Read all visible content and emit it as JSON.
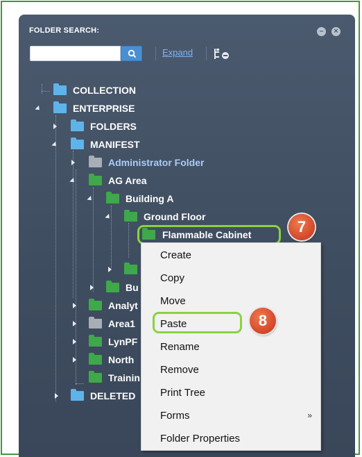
{
  "panel": {
    "title": "FOLDER SEARCH:",
    "minimize_icon": "minus-circle-icon",
    "close_icon": "close-circle-icon",
    "search": {
      "value": "",
      "placeholder": "",
      "button_icon": "search-icon"
    },
    "expand_label": "Expand",
    "tree_options_icon": "tree-options-icon"
  },
  "tree": {
    "items": [
      {
        "label": "COLLECTION",
        "color": "blue",
        "state": "leaf"
      },
      {
        "label": "ENTERPRISE",
        "color": "blue",
        "state": "expanded"
      },
      {
        "label": "FOLDERS",
        "color": "blue",
        "state": "collapsed"
      },
      {
        "label": "MANIFEST",
        "color": "blue",
        "state": "expanded"
      },
      {
        "label": "Administrator Folder",
        "color": "gray",
        "state": "collapsed"
      },
      {
        "label": "AG Area",
        "color": "green",
        "state": "expanded"
      },
      {
        "label": "Building A",
        "color": "green",
        "state": "expanded"
      },
      {
        "label": "Ground Floor",
        "color": "green",
        "state": "expanded"
      },
      {
        "label": "Flammable Cabinet",
        "color": "green",
        "state": "leaf",
        "selected": true
      },
      {
        "label": "",
        "color": "green",
        "state": "collapsed"
      },
      {
        "label": "Bu",
        "color": "green",
        "state": "collapsed"
      },
      {
        "label": "Analyt",
        "color": "green",
        "state": "collapsed"
      },
      {
        "label": "Area1",
        "color": "gray",
        "state": "collapsed"
      },
      {
        "label": "LynPF",
        "color": "green",
        "state": "collapsed"
      },
      {
        "label": "North",
        "color": "green",
        "state": "collapsed"
      },
      {
        "label": "Trainin",
        "color": "green",
        "state": "leaf"
      },
      {
        "label": "DELETED",
        "color": "blue",
        "state": "collapsed"
      }
    ]
  },
  "context_menu": {
    "items": [
      {
        "label": "Create"
      },
      {
        "label": "Copy"
      },
      {
        "label": "Move"
      },
      {
        "label": "Paste",
        "highlighted": true
      },
      {
        "label": "Rename"
      },
      {
        "label": "Remove"
      },
      {
        "label": "Print Tree"
      },
      {
        "label": "Forms",
        "submenu_indicator": "»"
      },
      {
        "label": "Folder Properties"
      }
    ]
  },
  "callouts": [
    {
      "number": "7"
    },
    {
      "number": "8"
    }
  ],
  "colors": {
    "panel_bg": "#4b5a6e",
    "folder_blue": "#5eb4ea",
    "folder_green": "#3fa84a",
    "folder_gray": "#a8aeb6",
    "highlight_green": "#8bd23f",
    "callout_orange": "#e0552f",
    "frame_green": "#3f9a3a",
    "link_blue": "#7fb4ef"
  }
}
